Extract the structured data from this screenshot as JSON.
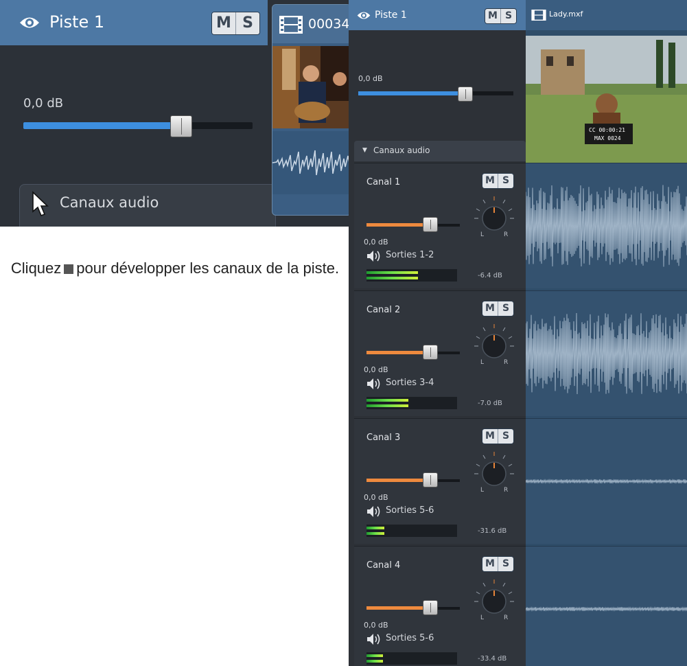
{
  "inset": {
    "track_title": "Piste 1",
    "mute_label": "M",
    "solo_label": "S",
    "volume_label": "0,0 dB",
    "volume_level": 0.69,
    "canaux_label": "Canaux audio",
    "clip_name": "00034.",
    "icons": {
      "eye": "eye-icon",
      "film": "film-icon",
      "expand": "expand-triangle-icon",
      "cursor": "mouse-pointer-icon"
    }
  },
  "caption": {
    "before": "Cliquez",
    "after": "pour développer les canaux de la piste."
  },
  "panel": {
    "track_title": "Piste 1",
    "mute_label": "M",
    "solo_label": "S",
    "volume_label": "0,0 dB",
    "volume_level": 0.71,
    "canaux_label": "Canaux audio",
    "clip_name": "Lady.mxf",
    "channels": [
      {
        "name": "Canal 1",
        "volume": "0,0 dB",
        "output": "Sorties 1-2",
        "meter_db": "-6.4 dB",
        "meter_level": 0.57,
        "knob_l": "L",
        "knob_r": "R"
      },
      {
        "name": "Canal 2",
        "volume": "0,0 dB",
        "output": "Sorties 3-4",
        "meter_db": "-7.0 dB",
        "meter_level": 0.46,
        "knob_l": "L",
        "knob_r": "R"
      },
      {
        "name": "Canal 3",
        "volume": "0,0 dB",
        "output": "Sorties 5-6",
        "meter_db": "-31.6 dB",
        "meter_level": 0.2,
        "knob_l": "L",
        "knob_r": "R"
      },
      {
        "name": "Canal 4",
        "volume": "0,0 dB",
        "output": "Sorties 5-6",
        "meter_db": "-33.4 dB",
        "meter_level": 0.18,
        "knob_l": "L",
        "knob_r": "R"
      }
    ]
  },
  "colors": {
    "track_header": "#4d78a4",
    "volume_fill": "#3d8fe0",
    "channel_fill": "#ee8a3e",
    "meter_green": "#6ee04a"
  }
}
